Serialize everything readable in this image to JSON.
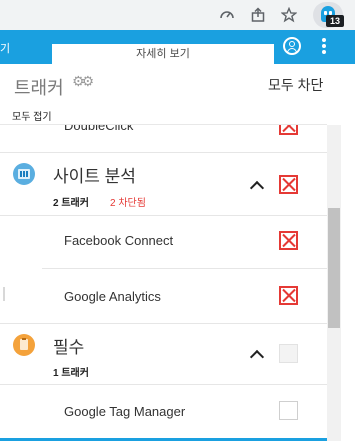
{
  "browser": {
    "icons": [
      "performance-icon",
      "share-icon",
      "star-icon",
      "extension-icon"
    ],
    "extension_badge": "13",
    "accent_color": "#1aa0e0"
  },
  "header": {
    "left_tab_label": "기",
    "active_tab_label": "자세히 보기"
  },
  "subheader": {
    "title": "트래커",
    "block_all_label": "모두 차단",
    "collapse_all_label": "모두 접기"
  },
  "list": {
    "partial_tracker": "DoubleClick",
    "categories": [
      {
        "title": "사이트 분석",
        "count": "2 트래커",
        "blocked": "2 차단됨",
        "icon": "analytics-icon",
        "trackers": [
          "Facebook Connect",
          "Google Analytics"
        ]
      },
      {
        "title": "필수",
        "count": "1 트래커",
        "icon": "essential-icon",
        "trackers": [
          "Google Tag Manager"
        ]
      }
    ]
  },
  "colors": {
    "blocked_red": "#e53935",
    "header_blue": "#1aa0e0"
  }
}
